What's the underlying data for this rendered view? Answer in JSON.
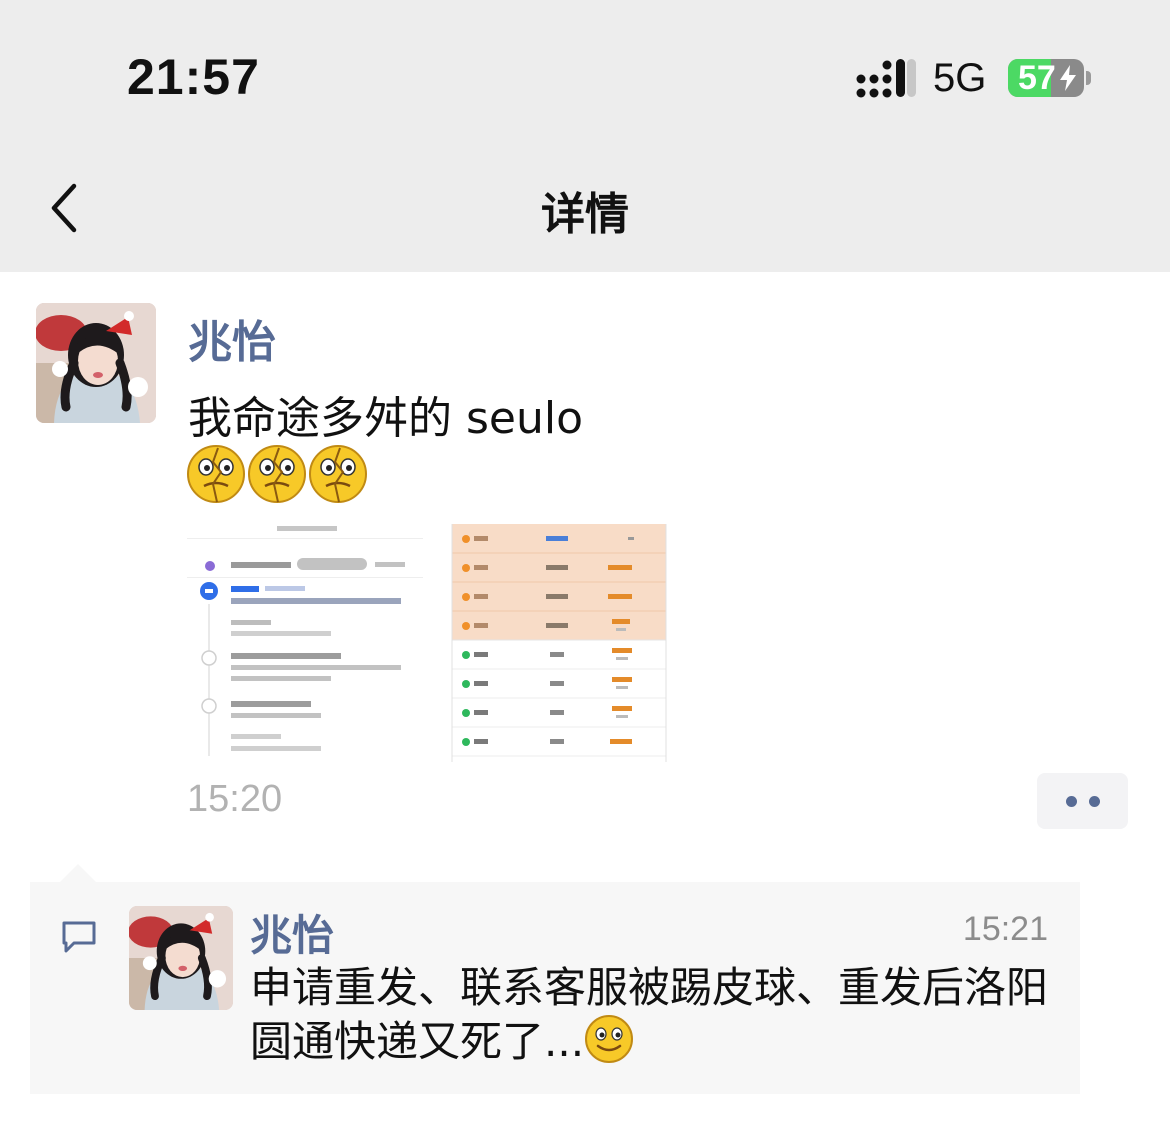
{
  "status_bar": {
    "time": "21:57",
    "network": "5G",
    "battery": "57",
    "battery_level": 0.57,
    "icons": [
      "signal-icon",
      "battery-icon",
      "charging-bolt-icon"
    ]
  },
  "nav": {
    "title": "详情",
    "back_icon": "chevron-left-icon"
  },
  "post": {
    "author": "兆怡",
    "text": "我命途多舛的 seulo",
    "emojis": [
      "broken-face-emoji",
      "broken-face-emoji",
      "broken-face-emoji"
    ],
    "images": [
      "shipment-tracking-screenshot",
      "order-list-screenshot"
    ],
    "time": "15:20",
    "more_icon": "more-dots-icon"
  },
  "comments": [
    {
      "author": "兆怡",
      "time": "15:21",
      "text": "申请重发、联系客服被踢皮球、重发后洛阳圆通快递又死了...",
      "emoji": "smile-emoji"
    }
  ],
  "colors": {
    "header_bg": "#ededed",
    "link": "#576b95",
    "battery_green": "#4cd964",
    "comment_bg": "#f7f7f7",
    "time_gray": "#b2b2b2"
  }
}
